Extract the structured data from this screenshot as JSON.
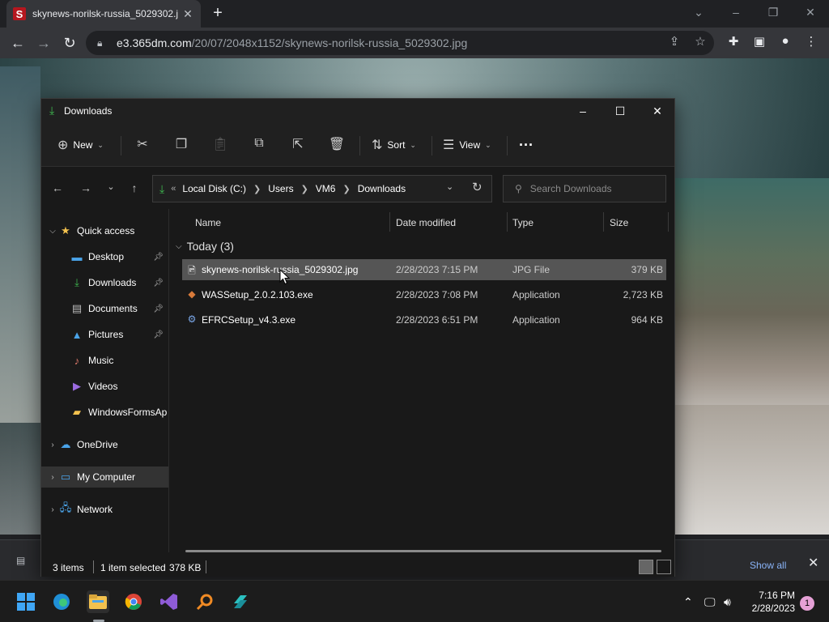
{
  "browser": {
    "tab_title": "skynews-norilsk-russia_5029302.j",
    "favicon_letter": "S",
    "url_host": "e3.365dm.com",
    "url_path": "/20/07/2048x1152/skynews-norilsk-russia_5029302.jpg",
    "shelf_show_all": "Show all"
  },
  "explorer": {
    "title": "Downloads",
    "toolbar": {
      "new_label": "New",
      "sort_label": "Sort",
      "view_label": "View",
      "more_label": "···"
    },
    "breadcrumb": [
      "Local Disk (C:)",
      "Users",
      "VM6",
      "Downloads"
    ],
    "search_placeholder": "Search Downloads",
    "nav": {
      "quick_access": "Quick access",
      "desktop": "Desktop",
      "downloads": "Downloads",
      "documents": "Documents",
      "pictures": "Pictures",
      "music": "Music",
      "videos": "Videos",
      "winforms": "WindowsFormsAp",
      "onedrive": "OneDrive",
      "my_computer": "My Computer",
      "network": "Network"
    },
    "columns": {
      "name": "Name",
      "date": "Date modified",
      "type": "Type",
      "size": "Size"
    },
    "group_label": "Today (3)",
    "files": [
      {
        "name": "skynews-norilsk-russia_5029302.jpg",
        "date": "2/28/2023 7:15 PM",
        "type": "JPG File",
        "size": "379 KB"
      },
      {
        "name": "WASSetup_2.0.2.103.exe",
        "date": "2/28/2023 7:08 PM",
        "type": "Application",
        "size": "2,723 KB"
      },
      {
        "name": "EFRCSetup_v4.3.exe",
        "date": "2/28/2023 6:51 PM",
        "type": "Application",
        "size": "964 KB"
      }
    ],
    "status": {
      "count": "3 items",
      "selected": "1 item selected",
      "size": "378 KB"
    }
  },
  "taskbar": {
    "time": "7:16 PM",
    "date": "2/28/2023",
    "notification_count": "1"
  },
  "colors": {
    "accent_green": "#3fb950",
    "link_blue": "#8ab4f8",
    "folder_yellow": "#f2c14e"
  }
}
